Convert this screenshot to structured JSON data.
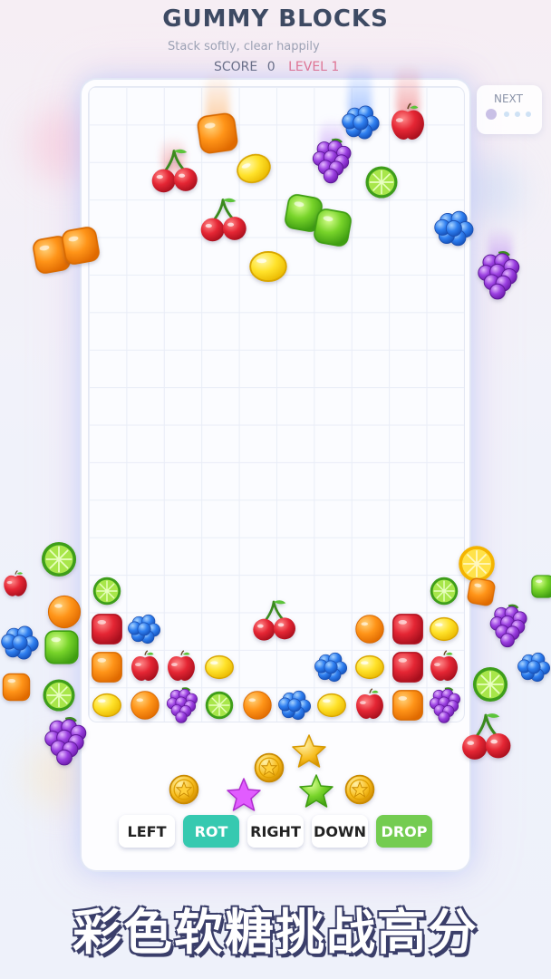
{
  "header": {
    "title": "GUMMY BLOCKS",
    "subtitle": "Stack softly, clear happily",
    "score_label": "SCORE",
    "score_value": "0",
    "level_label": "LEVEL 1"
  },
  "next_panel": {
    "label": "NEXT"
  },
  "controls": {
    "left": "LEFT",
    "rot": "ROT",
    "right": "RIGHT",
    "down": "DOWN",
    "drop": "DROP"
  },
  "caption": "彩色软糖挑战高分",
  "colors": {
    "title": "#3d4a63",
    "level": "#e26a86",
    "rot_button": "#36c9b0",
    "drop_button": "#74cc51"
  }
}
